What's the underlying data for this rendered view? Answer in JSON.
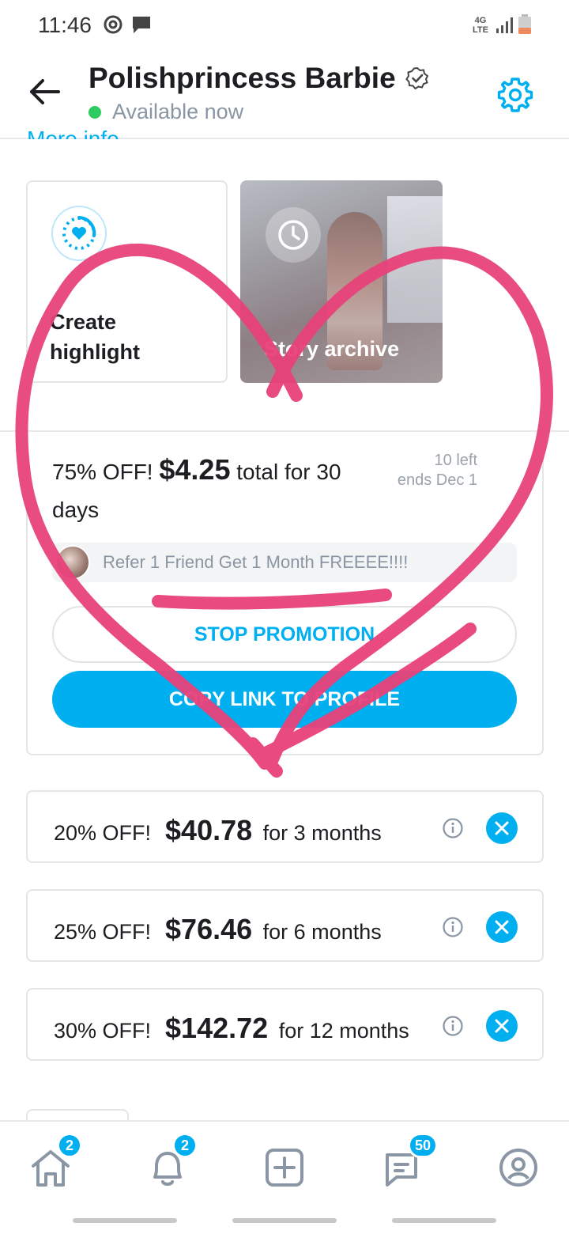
{
  "status_bar": {
    "time": "11:46",
    "network": "4G LTE"
  },
  "header": {
    "title": "Polishprincess Barbie",
    "status": "Available now",
    "more_info": "More info"
  },
  "highlights": {
    "create_label": "Create highlight",
    "archive_label": "Story archive"
  },
  "promotion": {
    "discount": "75% OFF!",
    "price": "$4.25",
    "description": "total for 30 days",
    "remaining": "10 left",
    "ends": "ends Dec 1",
    "message": "Refer 1 Friend Get 1 Month FREEEE!!!!",
    "stop_label": "STOP PROMOTION",
    "copy_label": "COPY LINK TO PROFILE"
  },
  "bundles": [
    {
      "discount": "20% OFF!",
      "price": "$40.78",
      "duration": "for 3 months"
    },
    {
      "discount": "25% OFF!",
      "price": "$76.46",
      "duration": "for 6 months"
    },
    {
      "discount": "30% OFF!",
      "price": "$142.72",
      "duration": "for 12 months"
    }
  ],
  "nav": {
    "home_badge": "2",
    "notifications_badge": "2",
    "messages_badge": "50"
  },
  "colors": {
    "accent": "#00aff0",
    "online": "#2ecc60",
    "drawing": "#e8427a"
  }
}
